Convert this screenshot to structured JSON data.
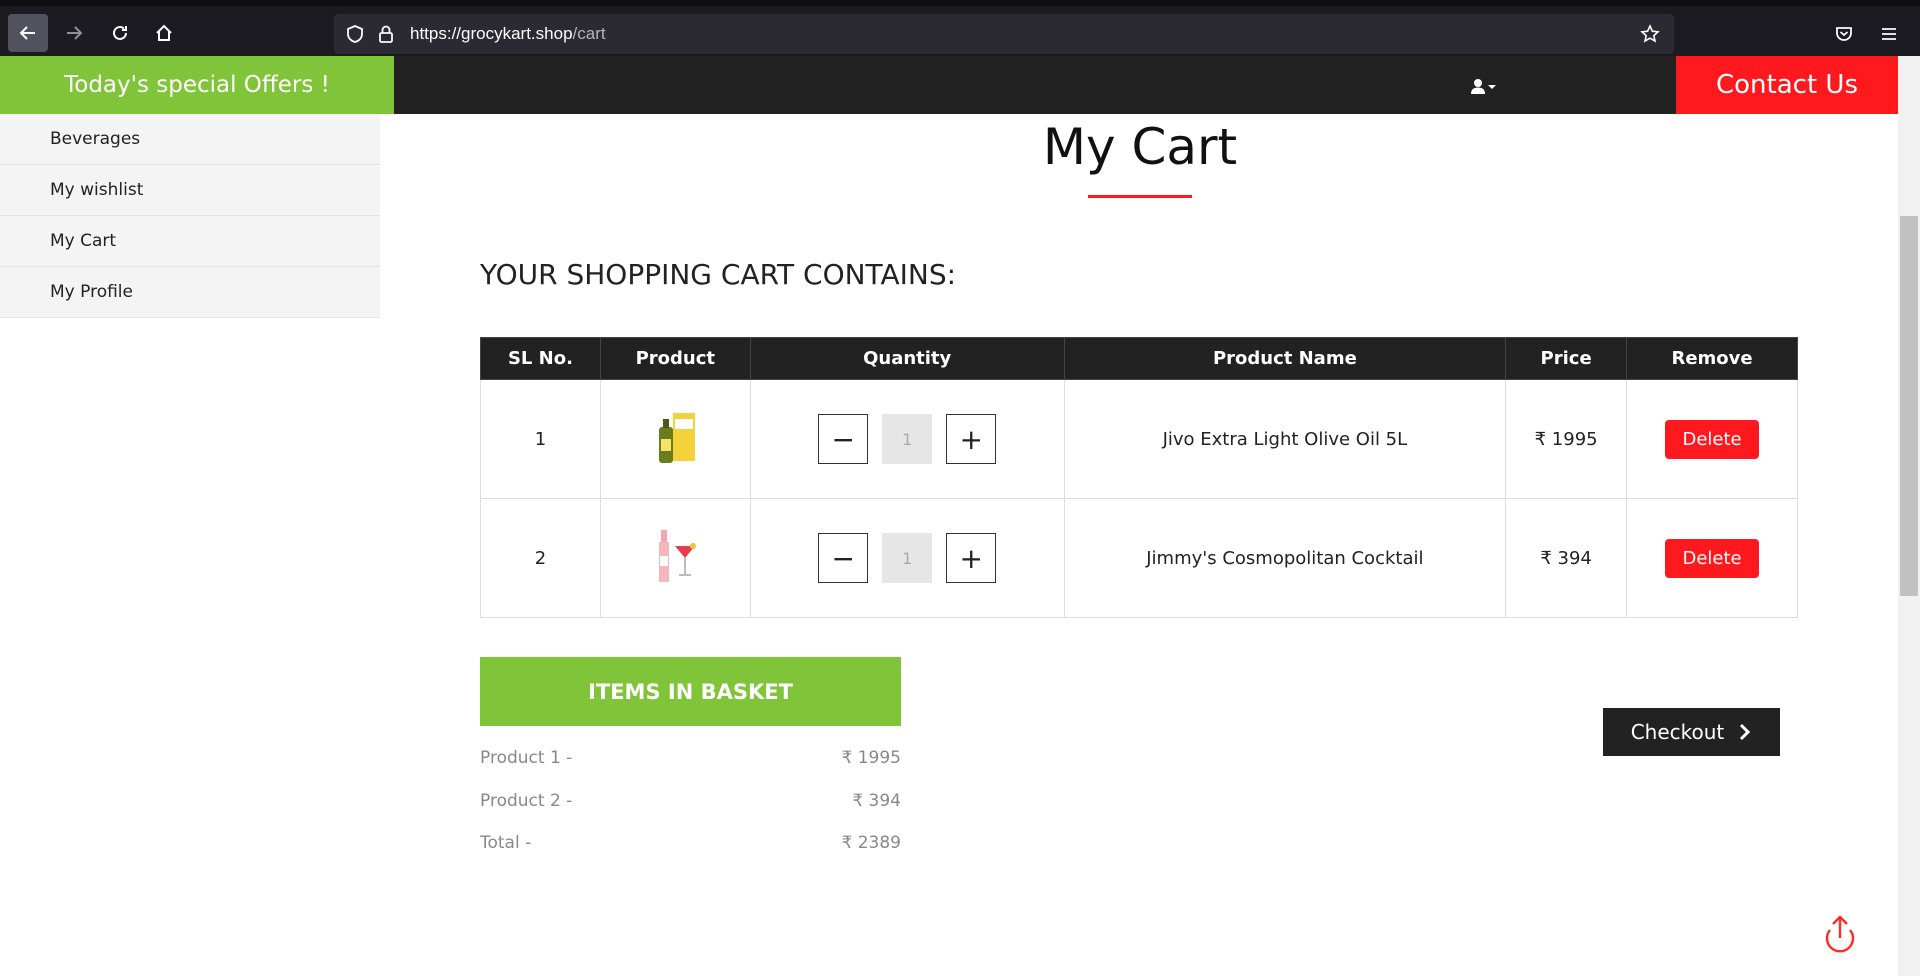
{
  "browser": {
    "url_host": "https://grocykart.shop",
    "url_path": "/cart"
  },
  "header": {
    "offers_label": "Today's special Offers !",
    "contact_label": "Contact Us"
  },
  "sidebar": {
    "items": [
      {
        "label": "Beverages"
      },
      {
        "label": "My wishlist"
      },
      {
        "label": "My Cart"
      },
      {
        "label": "My Profile"
      }
    ]
  },
  "main": {
    "title": "My Cart",
    "subtitle": "YOUR SHOPPING CART CONTAINS:"
  },
  "table": {
    "headers": [
      "SL No.",
      "Product",
      "Quantity",
      "Product Name",
      "Price",
      "Remove"
    ],
    "rows": [
      {
        "sl": "1",
        "image_icon": "olive-oil-product-image",
        "qty": "1",
        "name": "Jivo Extra Light Olive Oil 5L",
        "price": "₹ 1995",
        "remove": "Delete"
      },
      {
        "sl": "2",
        "image_icon": "cocktail-product-image",
        "qty": "1",
        "name": "Jimmy's Cosmopolitan Cocktail",
        "price": "₹ 394",
        "remove": "Delete"
      }
    ]
  },
  "basket": {
    "heading": "ITEMS IN BASKET",
    "lines": [
      {
        "label": "Product 1 -",
        "value": "₹ 1995"
      },
      {
        "label": "Product 2 -",
        "value": "₹ 394"
      },
      {
        "label": "Total -",
        "value": "₹ 2389"
      }
    ]
  },
  "checkout_label": "Checkout",
  "colors": {
    "accent_green": "#80c43a",
    "accent_red": "#ff181e",
    "dark": "#222222"
  }
}
